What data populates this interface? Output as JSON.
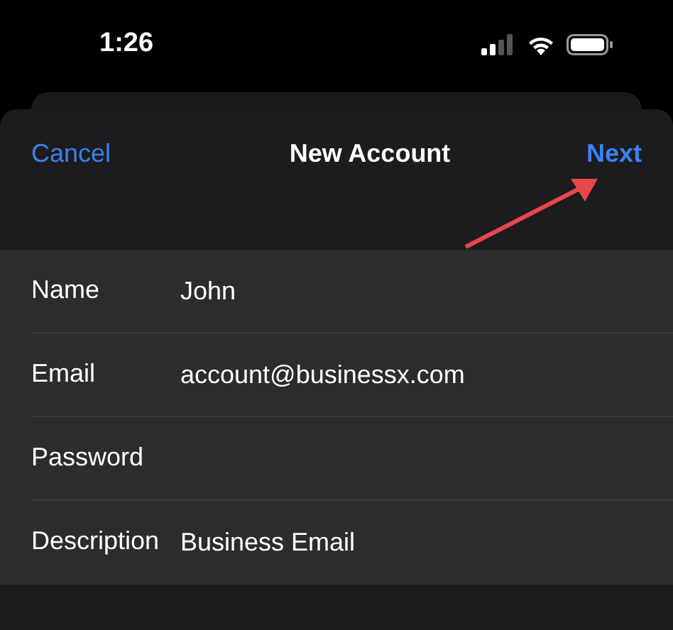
{
  "status_bar": {
    "time": "1:26"
  },
  "nav": {
    "cancel": "Cancel",
    "title": "New Account",
    "next": "Next"
  },
  "fields": [
    {
      "label": "Name",
      "value": "John"
    },
    {
      "label": "Email",
      "value": "account@businessx.com"
    },
    {
      "label": "Password"
    },
    {
      "label": "Description",
      "value": "Business Email"
    }
  ]
}
